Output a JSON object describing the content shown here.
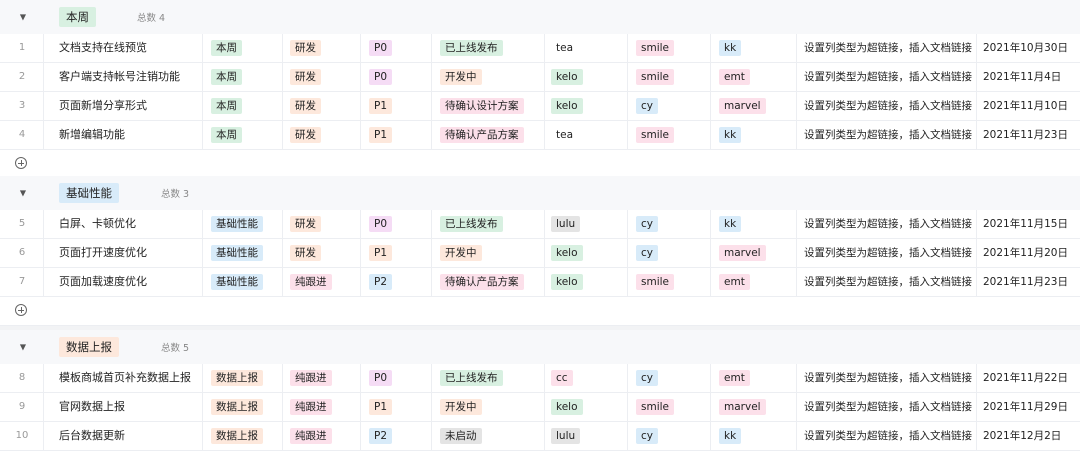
{
  "colors": {
    "本周": "#d8f0e1",
    "基础性能": "#d8ebf9",
    "数据上报": "#fde8dc",
    "研发": "#fde8dc",
    "纯跟进": "#fce0ea",
    "P0": "#f5dcf5",
    "P1": "#fde8dc",
    "P2": "#d8ebf9",
    "已上线发布": "#d8f0e1",
    "开发中": "#fde8dc",
    "待确认设计方案": "#fce0ea",
    "待确认产品方案": "#fce0ea",
    "未启动": "#e4e4e4",
    "tea": "#ffffff",
    "kelo": "#d8f0e1",
    "lulu": "#e4e4e4",
    "cc": "#fce0ea",
    "smile": "#fce0ea",
    "cy": "#d8ebf9",
    "kk": "#d8ebf9",
    "emt": "#fce0ea",
    "marvel": "#fce0ea"
  },
  "groups": [
    {
      "name": "本周",
      "count_label": "总数 4",
      "rows": [
        {
          "num": "1",
          "title": "文档支持在线预览",
          "tag": "本周",
          "type": "研发",
          "priority": "P0",
          "status": "已上线发布",
          "owner": "tea",
          "designer": "smile",
          "tester": "kk",
          "link": "设置列类型为超链接，插入文档链接",
          "date": "2021年10月30日"
        },
        {
          "num": "2",
          "title": "客户端支持帐号注销功能",
          "tag": "本周",
          "type": "研发",
          "priority": "P0",
          "status": "开发中",
          "owner": "kelo",
          "designer": "smile",
          "tester": "emt",
          "link": "设置列类型为超链接，插入文档链接",
          "date": "2021年11月4日"
        },
        {
          "num": "3",
          "title": "页面新增分享形式",
          "tag": "本周",
          "type": "研发",
          "priority": "P1",
          "status": "待确认设计方案",
          "owner": "kelo",
          "designer": "cy",
          "tester": "marvel",
          "link": "设置列类型为超链接，插入文档链接",
          "date": "2021年11月10日"
        },
        {
          "num": "4",
          "title": "新增编辑功能",
          "tag": "本周",
          "type": "研发",
          "priority": "P1",
          "status": "待确认产品方案",
          "owner": "tea",
          "designer": "smile",
          "tester": "kk",
          "link": "设置列类型为超链接，插入文档链接",
          "date": "2021年11月23日"
        }
      ]
    },
    {
      "name": "基础性能",
      "count_label": "总数 3",
      "rows": [
        {
          "num": "5",
          "title": "白屏、卡顿优化",
          "tag": "基础性能",
          "type": "研发",
          "priority": "P0",
          "status": "已上线发布",
          "owner": "lulu",
          "designer": "cy",
          "tester": "kk",
          "link": "设置列类型为超链接，插入文档链接",
          "date": "2021年11月15日"
        },
        {
          "num": "6",
          "title": "页面打开速度优化",
          "tag": "基础性能",
          "type": "研发",
          "priority": "P1",
          "status": "开发中",
          "owner": "kelo",
          "designer": "cy",
          "tester": "marvel",
          "link": "设置列类型为超链接，插入文档链接",
          "date": "2021年11月20日"
        },
        {
          "num": "7",
          "title": "页面加载速度优化",
          "tag": "基础性能",
          "type": "纯跟进",
          "priority": "P2",
          "status": "待确认产品方案",
          "owner": "kelo",
          "designer": "smile",
          "tester": "emt",
          "link": "设置列类型为超链接，插入文档链接",
          "date": "2021年11月23日"
        }
      ]
    },
    {
      "name": "数据上报",
      "count_label": "总数 5",
      "rows": [
        {
          "num": "8",
          "title": "模板商城首页补充数据上报",
          "tag": "数据上报",
          "type": "纯跟进",
          "priority": "P0",
          "status": "已上线发布",
          "owner": "cc",
          "designer": "cy",
          "tester": "emt",
          "link": "设置列类型为超链接，插入文档链接",
          "date": "2021年11月22日"
        },
        {
          "num": "9",
          "title": "官网数据上报",
          "tag": "数据上报",
          "type": "纯跟进",
          "priority": "P1",
          "status": "开发中",
          "owner": "kelo",
          "designer": "smile",
          "tester": "marvel",
          "link": "设置列类型为超链接，插入文档链接",
          "date": "2021年11月29日"
        },
        {
          "num": "10",
          "title": "后台数据更新",
          "tag": "数据上报",
          "type": "纯跟进",
          "priority": "P2",
          "status": "未启动",
          "owner": "lulu",
          "designer": "cy",
          "tester": "kk",
          "link": "设置列类型为超链接，插入文档链接",
          "date": "2021年12月2日"
        }
      ]
    }
  ]
}
